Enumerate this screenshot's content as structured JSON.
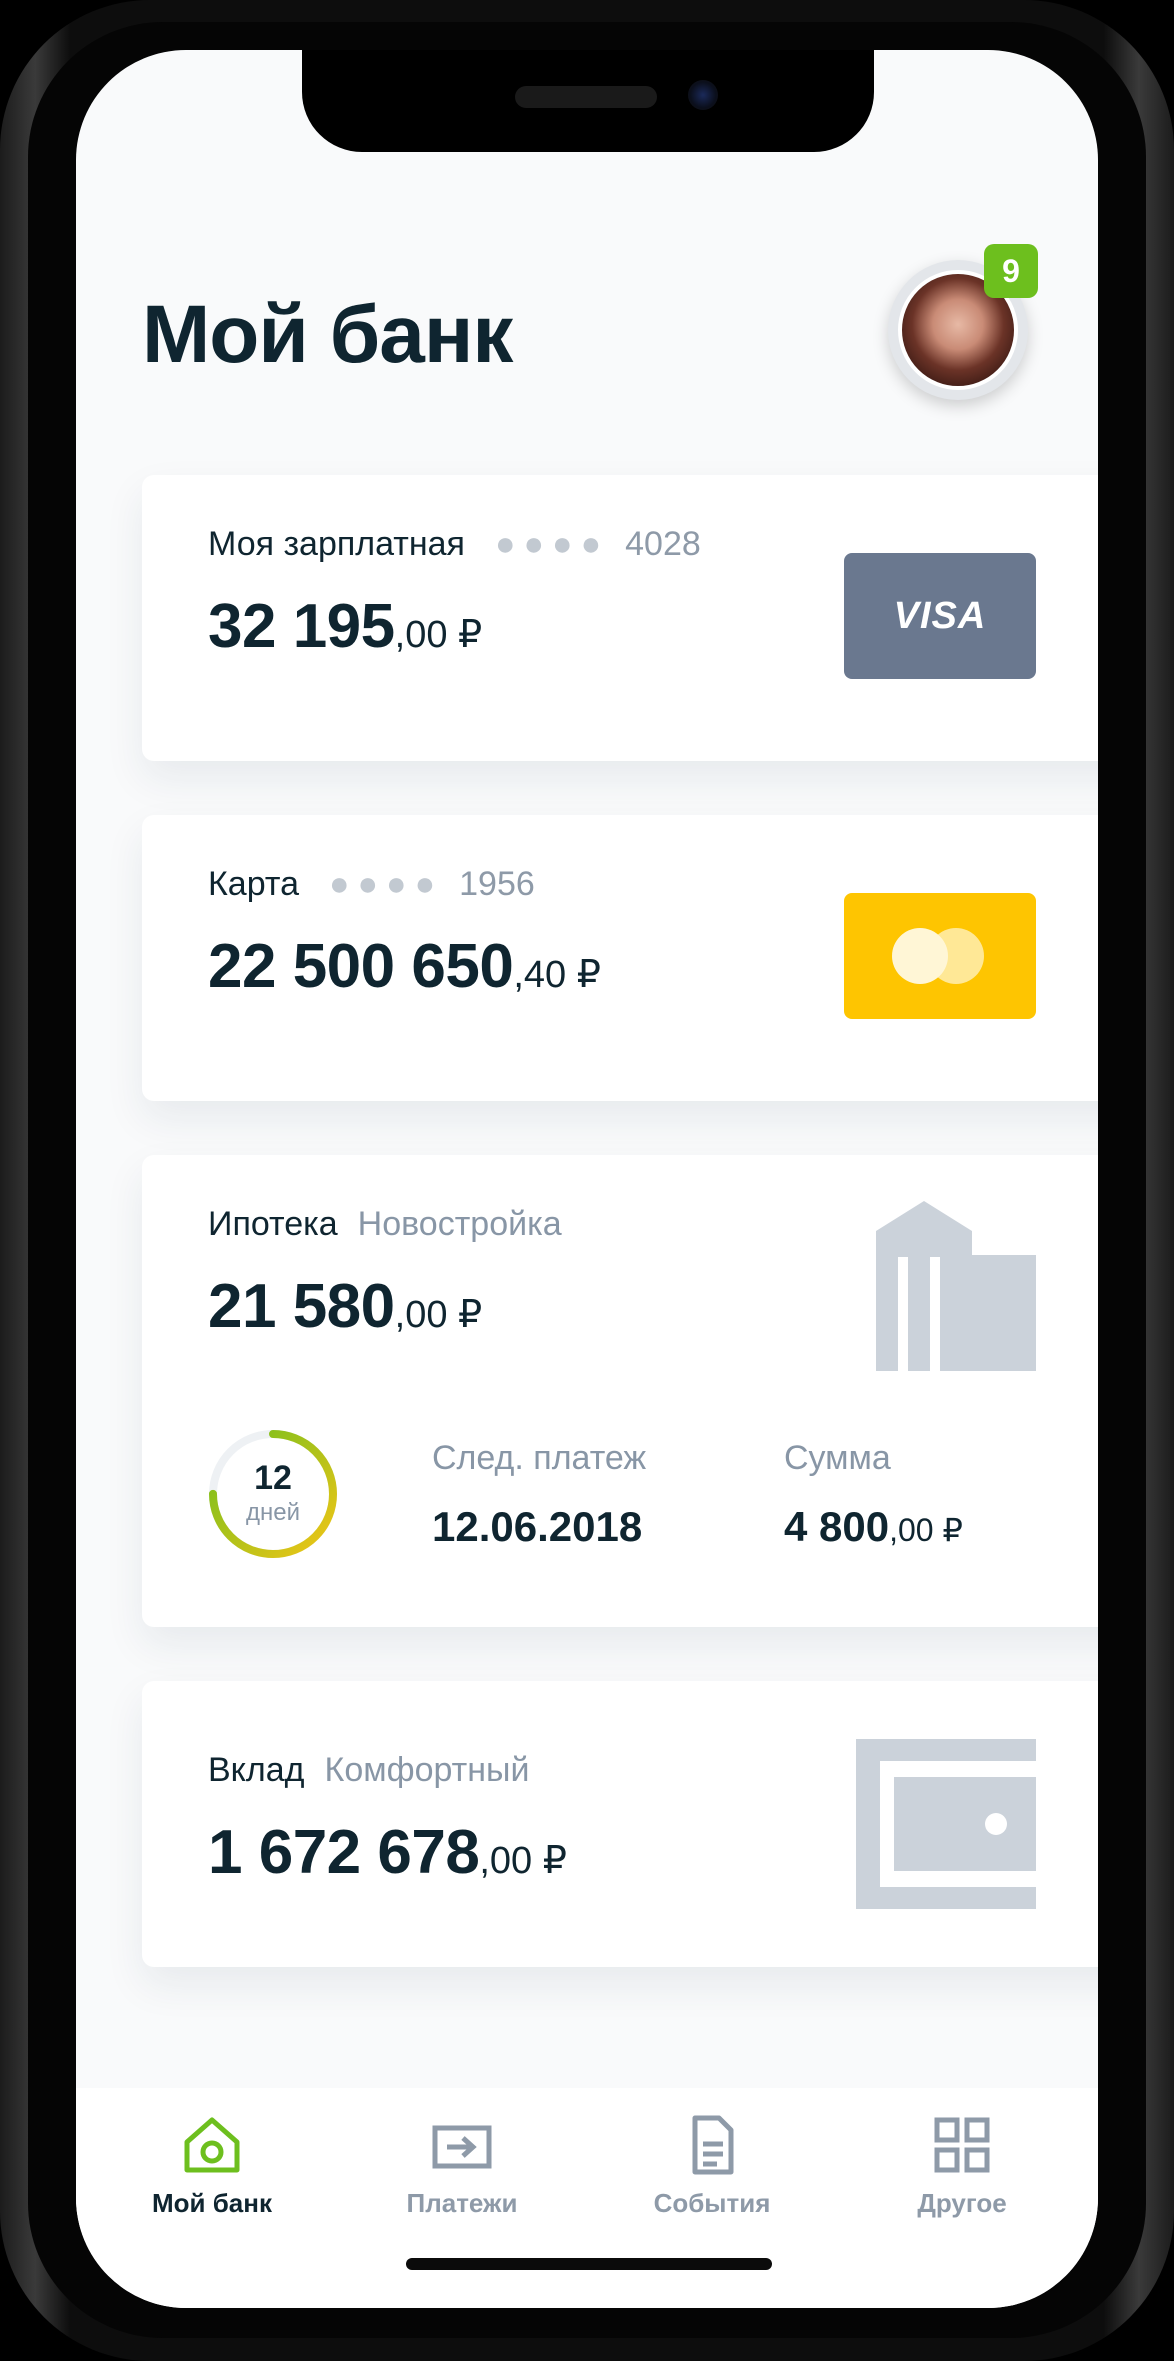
{
  "header": {
    "title": "Мой банк",
    "notifications_count": "9"
  },
  "cards": [
    {
      "title": "Моя зарплатная",
      "dots": "●●●●",
      "last_digits": "4028",
      "amount_main": "32 195",
      "amount_fraction": ",00 ₽",
      "brand": "VISA"
    },
    {
      "title": "Карта",
      "dots": "●●●●",
      "last_digits": "1956",
      "amount_main": "22 500 650",
      "amount_fraction": ",40 ₽",
      "brand": "mastercard-icon"
    },
    {
      "title": "Ипотека",
      "subtitle": "Новостройка",
      "amount_main": "21 580",
      "amount_fraction": ",00 ₽",
      "icon": "bank-building-icon",
      "days_left": "12",
      "days_unit": "дней",
      "days_progress": 0.75,
      "next_payment_label": "След. платеж",
      "next_payment_date": "12.06.2018",
      "sum_label": "Сумма",
      "sum_main": "4 800",
      "sum_fraction": ",00 ₽"
    },
    {
      "title": "Вклад",
      "subtitle": "Комфортный",
      "amount_main": "1 672 678",
      "amount_fraction": ",00 ₽",
      "icon": "safe-icon"
    }
  ],
  "tabbar": {
    "items": [
      {
        "label": "Мой банк",
        "icon": "home-icon",
        "active": true
      },
      {
        "label": "Платежи",
        "icon": "payments-icon",
        "active": false
      },
      {
        "label": "События",
        "icon": "document-icon",
        "active": false
      },
      {
        "label": "Другое",
        "icon": "grid-icon",
        "active": false
      }
    ]
  },
  "colors": {
    "accent": "#7cbf1a",
    "text_dark": "#0f2530",
    "text_muted": "#8896a6",
    "visa_bg": "#6a788f",
    "mastercard_bg": "#fec501"
  }
}
